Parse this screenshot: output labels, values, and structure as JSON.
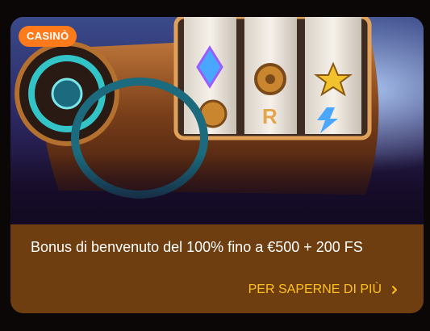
{
  "card": {
    "badge": "CASINÒ",
    "title": "Bonus di benvenuto del 100% fino a €500 + 200 FS",
    "cta": "PER SAPERNE DI PIÙ",
    "cta_icon": "chevron-right-icon",
    "image": "slot-machine-reels-illustration"
  },
  "colors": {
    "badge_bg": "#ff7a1a",
    "panel_bg": "#6e3d10",
    "cta_text": "#ffc21a",
    "page_bg": "#0c0707"
  }
}
